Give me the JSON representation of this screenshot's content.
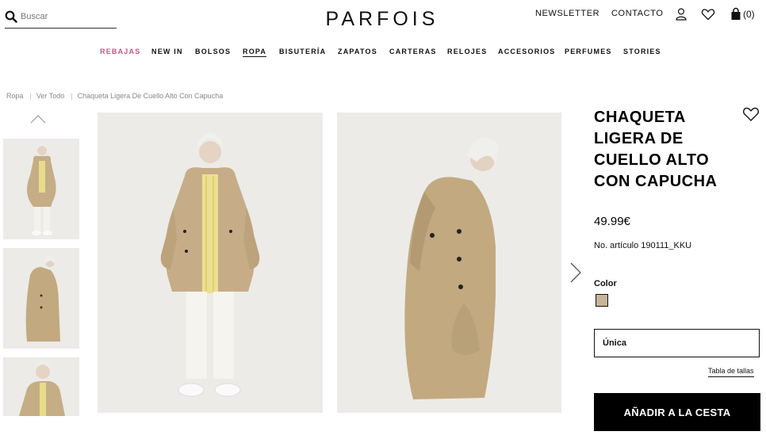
{
  "header": {
    "search_placeholder": "Buscar",
    "logo_text": "PARFOIS",
    "newsletter": "NEWSLETTER",
    "contact": "CONTACTO",
    "cart_count": "(0)"
  },
  "nav": {
    "items": [
      "REBAJAS",
      "NEW IN",
      "BOLSOS",
      "ROPA",
      "BISUTERÍA",
      "ZAPATOS",
      "CARTERAS",
      "RELOJES",
      "ACCESORIOS",
      "PERFUMES",
      "STORIES"
    ],
    "active": "ROPA",
    "sale_color": "#c8558a"
  },
  "breadcrumb": [
    "Ropa",
    "Ver Todo",
    "Chaqueta Ligera De Cuello Alto Con Capucha"
  ],
  "product": {
    "title": "CHAQUETA LIGERA DE CUELLO ALTO CON CAPUCHA",
    "price": "49.99€",
    "sku": "No. artículo 190111_KKU",
    "color_label": "Color",
    "swatch_color": "#c8b49a",
    "size_selected": "Única",
    "size_table": "Tabla de tallas",
    "add_to_cart": "AÑADIR A LA CESTA"
  },
  "icons": [
    "search-icon",
    "user-icon",
    "heart-icon",
    "bag-icon",
    "chevron-up-icon",
    "chevron-right-icon"
  ]
}
